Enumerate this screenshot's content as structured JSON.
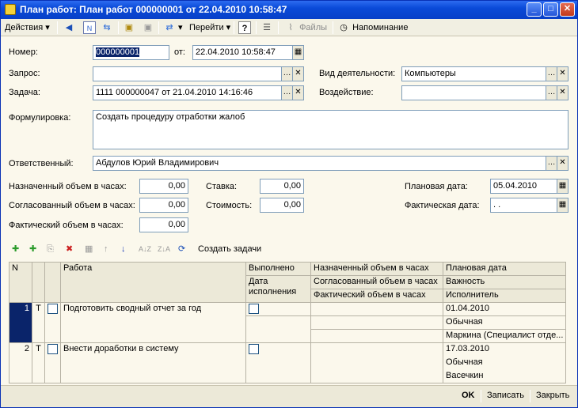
{
  "window": {
    "title": "План работ: План работ 000000001 от 22.04.2010 10:58:47"
  },
  "toolbar": {
    "actions_label": "Действия",
    "go_label": "Перейти",
    "help_label": "?",
    "files_label": "Файлы",
    "reminder_label": "Напоминание"
  },
  "form": {
    "number_label": "Номер:",
    "number_value": "000000001",
    "date_label": "от:",
    "date_value": "22.04.2010 10:58:47",
    "request_label": "Запрос:",
    "request_value": "",
    "activity_label": "Вид деятельности:",
    "activity_value": "Компьютеры",
    "task_label": "Задача:",
    "task_value": "1111 000000047 от 21.04.2010 14:16:46",
    "impact_label": "Воздействие:",
    "impact_value": "",
    "wording_label": "Формулировка:",
    "wording_value": "Создать процедуру отработки жалоб",
    "responsible_label": "Ответственный:",
    "responsible_value": "Абдулов Юрий Владимирович",
    "assigned_hours_label": "Назначенный объем в часах:",
    "assigned_hours_value": "0,00",
    "rate_label": "Ставка:",
    "rate_value": "0,00",
    "planned_date_label": "Плановая дата:",
    "planned_date_value": "05.04.2010",
    "agreed_hours_label": "Согласованный объем в часах:",
    "agreed_hours_value": "0,00",
    "cost_label": "Стоимость:",
    "cost_value": "0,00",
    "actual_date_label": "Фактическая дата:",
    "actual_date_value": " .  .",
    "actual_hours_label": "Фактический объем в часах:",
    "actual_hours_value": "0,00"
  },
  "grid_toolbar": {
    "create_tasks_label": "Создать задачи"
  },
  "grid": {
    "headers": {
      "n": "N",
      "work": "Работа",
      "done": "Выполнено",
      "done_date": "Дата исполнения",
      "assigned": "Назначенный объем в часах",
      "agreed": "Согласованный объем в часах",
      "actual": "Фактический объем в часах",
      "planned_date": "Плановая дата",
      "importance": "Важность",
      "executor": "Исполнитель"
    },
    "rows": [
      {
        "n": "1",
        "t": "Т",
        "work": "Подготовить сводный отчет за год",
        "planned_date": "01.04.2010",
        "importance": "Обычная",
        "executor": "Маркина (Специалист отде..."
      },
      {
        "n": "2",
        "t": "Т",
        "work": "Внести доработки в систему",
        "planned_date": "17.03.2010",
        "importance": "Обычная",
        "executor": "Васечкин"
      }
    ]
  },
  "footer": {
    "ok_label": "OK",
    "save_label": "Записать",
    "close_label": "Закрыть"
  }
}
